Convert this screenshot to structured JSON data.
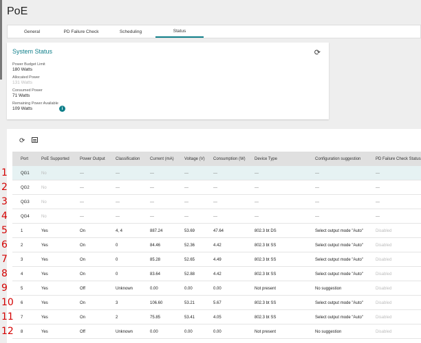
{
  "page_title": "PoE",
  "tabs": [
    {
      "label": "General",
      "active": false
    },
    {
      "label": "PD Failure Check",
      "active": false
    },
    {
      "label": "Scheduling",
      "active": false
    },
    {
      "label": "Status",
      "active": true
    }
  ],
  "system_status": {
    "title": "System Status",
    "stats": [
      {
        "label": "Power Budget Limit",
        "value": "180 Watts",
        "dim": false
      },
      {
        "label": "Allocated Power",
        "value": "131 Watts",
        "dim": true
      },
      {
        "label": "Consumed Power",
        "value": "71 Watts",
        "dim": false
      },
      {
        "label": "Remaining Power Available",
        "value": "109 Watts",
        "dim": false
      }
    ]
  },
  "table": {
    "columns": [
      "Port",
      "PoE Supported",
      "Power Output",
      "Classification",
      "Current (mA)",
      "Voltage (V)",
      "Consumption (W)",
      "Device Type",
      "Configuration suggestion",
      "PD Failure Check Status"
    ],
    "rows": [
      [
        "QG1",
        "No",
        "—",
        "—",
        "—",
        "—",
        "—",
        "—",
        "—",
        "—"
      ],
      [
        "QG2",
        "No",
        "—",
        "—",
        "—",
        "—",
        "—",
        "—",
        "—",
        "—"
      ],
      [
        "QG3",
        "No",
        "—",
        "—",
        "—",
        "—",
        "—",
        "—",
        "—",
        "—"
      ],
      [
        "QG4",
        "No",
        "—",
        "—",
        "—",
        "—",
        "—",
        "—",
        "—",
        "—"
      ],
      [
        "1",
        "Yes",
        "On",
        "4, 4",
        "887.24",
        "53.69",
        "47.64",
        "802.3 bt DS",
        "Select output mode \"Auto\"",
        "Disabled"
      ],
      [
        "2",
        "Yes",
        "On",
        "0",
        "84.46",
        "52.36",
        "4.42",
        "802.3 bt SS",
        "Select output mode \"Auto\"",
        "Disabled"
      ],
      [
        "3",
        "Yes",
        "On",
        "0",
        "85.28",
        "52.65",
        "4.49",
        "802.3 bt SS",
        "Select output mode \"Auto\"",
        "Disabled"
      ],
      [
        "4",
        "Yes",
        "On",
        "0",
        "83.64",
        "52.88",
        "4.42",
        "802.3 bt SS",
        "Select output mode \"Auto\"",
        "Disabled"
      ],
      [
        "5",
        "Yes",
        "Off",
        "Unknown",
        "0.00",
        "0.00",
        "0.00",
        "Not present",
        "No suggestion",
        "Disabled"
      ],
      [
        "6",
        "Yes",
        "On",
        "3",
        "106.60",
        "53.21",
        "5.67",
        "802.3 bt SS",
        "Select output mode \"Auto\"",
        "Disabled"
      ],
      [
        "7",
        "Yes",
        "On",
        "2",
        "75.85",
        "53.41",
        "4.05",
        "802.3 bt SS",
        "Select output mode \"Auto\"",
        "Disabled"
      ],
      [
        "8",
        "Yes",
        "Off",
        "Unknown",
        "0.00",
        "0.00",
        "0.00",
        "Not present",
        "No suggestion",
        "Disabled"
      ]
    ]
  },
  "annotations": [
    "1",
    "2",
    "3",
    "4",
    "5",
    "6",
    "7",
    "8",
    "9",
    "10",
    "11",
    "12"
  ],
  "colors": {
    "accent": "#0f7f8a",
    "annotation": "#d40000",
    "highlight_row": "#e6f2f3"
  },
  "icons": {
    "refresh": "refresh-icon",
    "export": "export-icon",
    "info": "info-icon"
  }
}
